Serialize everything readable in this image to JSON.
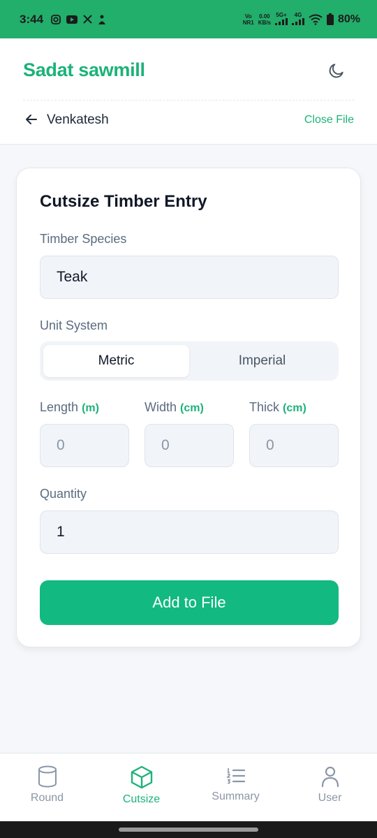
{
  "status_bar": {
    "time": "3:44",
    "network_left": "Vo",
    "network_left_sub": "NR1",
    "speed": "0.00",
    "speed_unit": "KB/s",
    "signal1": "5G+",
    "signal2": "4G",
    "battery": "80%"
  },
  "header": {
    "brand": "Sadat sawmill",
    "file_name": "Venkatesh",
    "close_file": "Close File",
    "accent": "#1cb27a"
  },
  "form": {
    "title": "Cutsize Timber Entry",
    "species_label": "Timber Species",
    "species_value": "Teak",
    "unit_label": "Unit System",
    "unit_options": [
      "Metric",
      "Imperial"
    ],
    "unit_selected": "Metric",
    "length_label": "Length",
    "length_unit": "(m)",
    "length_value": "0",
    "width_label": "Width",
    "width_unit": "(cm)",
    "width_value": "0",
    "thick_label": "Thick",
    "thick_unit": "(cm)",
    "thick_value": "0",
    "quantity_label": "Quantity",
    "quantity_value": "1",
    "submit_label": "Add to File",
    "button_color": "#12b981"
  },
  "nav": {
    "items": [
      {
        "label": "Round",
        "icon": "cylinder-icon"
      },
      {
        "label": "Cutsize",
        "icon": "box-icon"
      },
      {
        "label": "Summary",
        "icon": "list-icon"
      },
      {
        "label": "User",
        "icon": "user-icon"
      }
    ],
    "active": "Cutsize"
  }
}
